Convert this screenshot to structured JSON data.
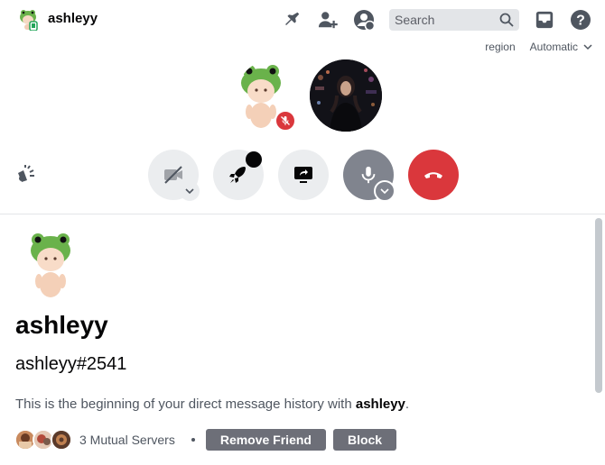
{
  "header": {
    "title": "ashleyy",
    "search_placeholder": "Search",
    "icons": [
      "pin-icon",
      "add-friend-icon",
      "profile-icon",
      "search-icon",
      "inbox-icon",
      "help-icon"
    ]
  },
  "region": {
    "label": "region",
    "value": "Automatic"
  },
  "call": {
    "controls": [
      "camera-off-button",
      "activity-button",
      "screen-share-button",
      "mic-button",
      "disconnect-button"
    ]
  },
  "profile": {
    "name": "ashleyy",
    "tag": "ashleyy#2541",
    "intro_prefix": "This is the beginning of your direct message history with ",
    "intro_name": "ashleyy",
    "intro_suffix": ".",
    "mutual_servers": "3 Mutual Servers",
    "remove_friend_label": "Remove Friend",
    "block_label": "Block"
  },
  "colors": {
    "danger": "#da373c",
    "button_gray": "#6d6f78",
    "mic_gray": "#80848e",
    "frog_green": "#6ab24b"
  }
}
